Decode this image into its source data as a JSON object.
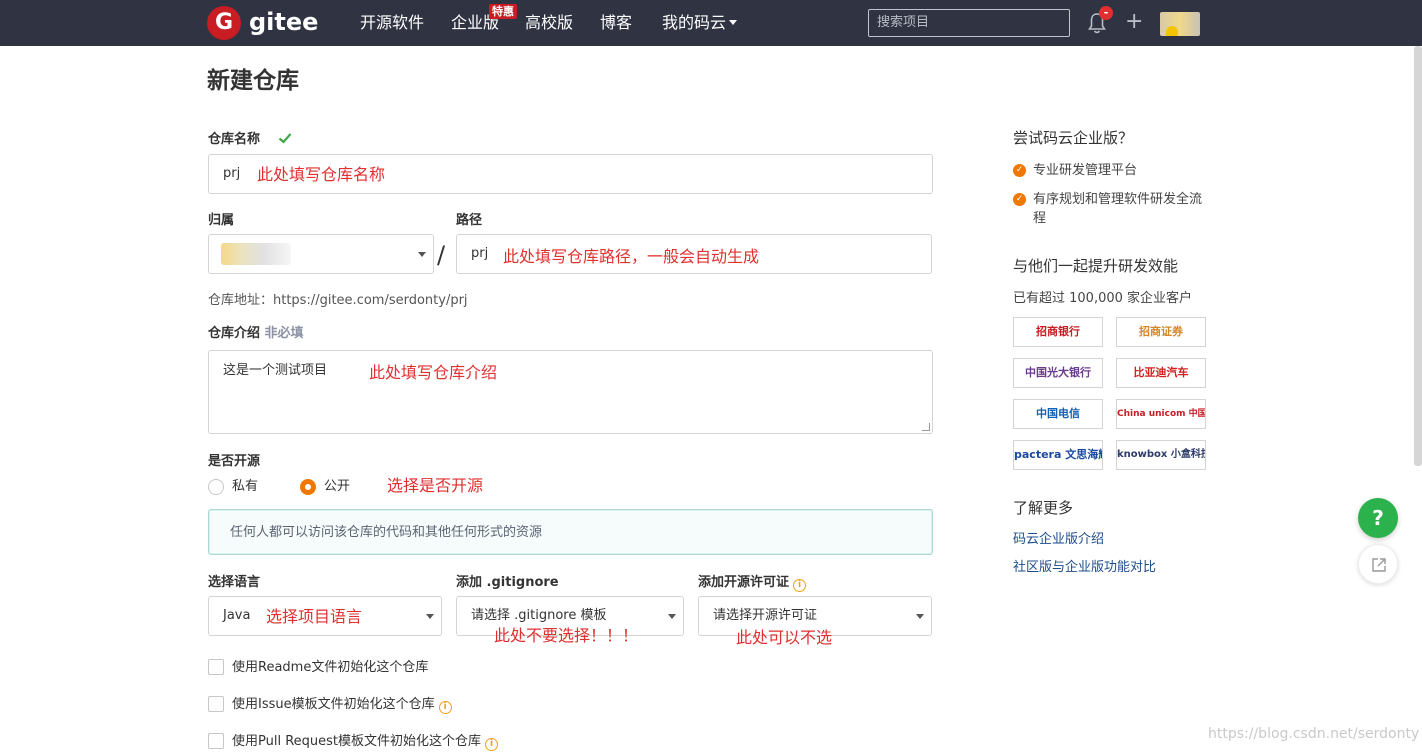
{
  "nav": {
    "logo_letter": "G",
    "logo_text": "gitee",
    "items": [
      "开源软件",
      "企业版",
      "高校版",
      "博客",
      "我的码云"
    ],
    "badge": "特惠",
    "search_placeholder": "搜索项目",
    "bell_badge": "-"
  },
  "page_title": "新建仓库",
  "form": {
    "repo_name_label": "仓库名称",
    "repo_name_value": "prj",
    "repo_name_note": "此处填写仓库名称",
    "owner_label": "归属",
    "path_label": "路径",
    "path_value": "prj",
    "path_note": "此处填写仓库路径，一般会自动生成",
    "repo_url": "仓库地址：https://gitee.com/serdonty/prj",
    "desc_label": "仓库介绍",
    "desc_optional": "非必填",
    "desc_value": "这是一个测试项目",
    "desc_note": "此处填写仓库介绍",
    "open_label": "是否开源",
    "private_label": "私有",
    "public_label": "公开",
    "open_note": "选择是否开源",
    "public_notice": "任何人都可以访问该仓库的代码和其他任何形式的资源",
    "lang_label": "选择语言",
    "lang_value": "Java",
    "lang_note": "选择项目语言",
    "gitignore_label": "添加 .gitignore",
    "gitignore_value": "请选择 .gitignore 模板",
    "gitignore_note": "此处不要选择！！！",
    "license_label": "添加开源许可证",
    "license_value": "请选择开源许可证",
    "license_note": "此处可以不选",
    "check_readme": "使用Readme文件初始化这个仓库",
    "check_issue": "使用Issue模板文件初始化这个仓库",
    "check_pr": "使用Pull Request模板文件初始化这个仓库"
  },
  "sidebar": {
    "try_title": "尝试码云企业版？",
    "features": [
      "专业研发管理平台",
      "有序规划和管理软件研发全流程"
    ],
    "together_title": "与他们一起提升研发效能",
    "customers": "已有超过 100,000 家企业客户",
    "logos": [
      "招商银行",
      "招商证券",
      "中国光大银行",
      "比亚迪汽车",
      "中国电信",
      "China unicom 中国联通",
      "pactera 文思海辉",
      "knowbox 小盒科技"
    ],
    "learn_title": "了解更多",
    "links": [
      "码云企业版介绍",
      "社区版与企业版功能对比"
    ]
  },
  "help_label": "?",
  "watermark": "https://blog.csdn.net/serdonty",
  "colors": {
    "topbar": "#2f3342",
    "brand_red": "#c71d23",
    "annotation": "#e03030",
    "radio_orange": "#f07800",
    "help_green": "#2bb24c"
  }
}
